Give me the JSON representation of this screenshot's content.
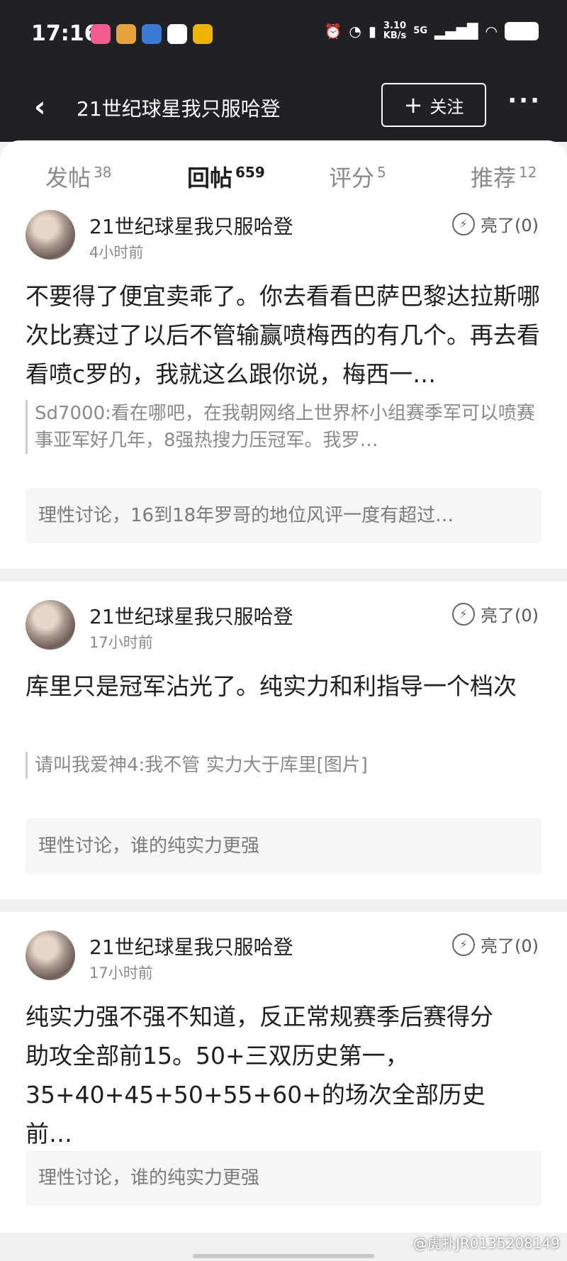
{
  "status_bar": {
    "time": "17:16",
    "net_speed_value": "3.10",
    "net_speed_unit": "KB/s",
    "network": "5G"
  },
  "header": {
    "title": "21世纪球星我只服哈登",
    "follow_label": "关注",
    "back_icon": "chevron-left-icon",
    "more_icon": "more-icon"
  },
  "tabs": [
    {
      "label": "发帖",
      "count": "38"
    },
    {
      "label": "回帖",
      "count": "659",
      "active": true
    },
    {
      "label": "评分",
      "count": "5"
    },
    {
      "label": "推荐",
      "count": "12"
    }
  ],
  "posts": [
    {
      "username": "21世纪球星我只服哈登",
      "time": "4小时前",
      "light": "亮了(0)",
      "content": "不要得了便宜卖乖了。你去看看巴萨巴黎达拉斯哪次比赛过了以后不管输赢喷梅西的有几个。再去看看喷c罗的，我就这么跟你说，梅西一…",
      "quote": "Sd7000:看在哪吧，在我朝网络上世界杯小组赛季军可以喷赛事亚军好几年，8强热搜力压冠军。我罗…",
      "topic": "理性讨论，16到18年罗哥的地位风评一度有超过…"
    },
    {
      "username": "21世纪球星我只服哈登",
      "time": "17小时前",
      "light": "亮了(0)",
      "content": "库里只是冠军沾光了。纯实力和利指导一个档次",
      "quote": "请叫我爱神4:我不管  实力大于库里[图片]",
      "topic": "理性讨论，谁的纯实力更强"
    },
    {
      "username": "21世纪球星我只服哈登",
      "time": "17小时前",
      "light": "亮了(0)",
      "content": "纯实力强不强不知道，反正常规赛季后赛得分助攻全部前15。50+三双历史第一，35+40+45+50+55+60+的场次全部历史前…",
      "topic": "理性讨论，谁的纯实力更强"
    }
  ],
  "watermark": "@虎扑JR0135208149"
}
